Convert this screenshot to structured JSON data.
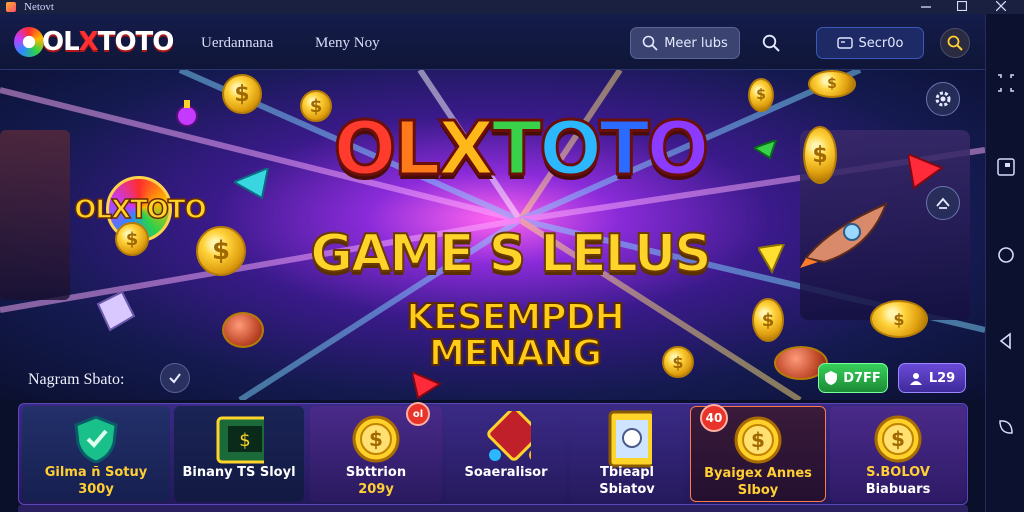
{
  "window": {
    "title": "Netovt",
    "controls": [
      "minimize",
      "maximize",
      "close"
    ]
  },
  "header": {
    "logo_prefix": "OL",
    "logo_x": "X",
    "logo_suffix": "TOTO",
    "nav": [
      "Uerdannana",
      "Meny Noy"
    ],
    "search_button": "Meer lubs",
    "secondary_button": "Secr0o",
    "icons": {
      "search": "search-icon",
      "lens": "search-icon",
      "user": "user-icon"
    }
  },
  "hero": {
    "badge_logo": "OLXTOTO",
    "title_letters": [
      "O",
      "L",
      "X",
      "T",
      "O",
      "T",
      "O"
    ],
    "title_colors": [
      "#ff3b2e",
      "#ff7a1a",
      "#ffb81a",
      "#3ad14a",
      "#2bb8ff",
      "#2b6bff",
      "#8a3bff"
    ],
    "subtitle": "GAME S LELUS",
    "tagline": "KESEMPDH MENANG",
    "chip_green": "D7FF",
    "chip_purple": "L29",
    "section_label": "Nagram Sbato:"
  },
  "games": [
    {
      "line1": "Gilma ñ Sotuy",
      "line2": "300y",
      "color1": "#ffcf33",
      "color2": "#ffcf33",
      "art": "shield-icon"
    },
    {
      "line1": "Binany TS Sloyl",
      "line2": "",
      "color1": "#ffffff",
      "color2": "#ffffff",
      "art": "slot-machine-icon"
    },
    {
      "line1": "Sbttrion",
      "line2": "209y",
      "color1": "#ffffff",
      "color2": "#ffcf33",
      "art": "coin-icon",
      "badge": "ol"
    },
    {
      "line1": "Soaeralisor",
      "line2": "",
      "color1": "#ffffff",
      "color2": "#ffffff",
      "art": "dice-icon"
    },
    {
      "line1": "Tbieapl",
      "line2": "Sbiatov",
      "color1": "#ffffff",
      "color2": "#ffffff",
      "art": "card-icon"
    },
    {
      "line1": "Byaigex Annes",
      "line2": "Slboy",
      "color1": "#ffcf33",
      "color2": "#ffcf33",
      "art": "coin-icon",
      "badge": "40"
    },
    {
      "line1": "S.BOLOV",
      "line2": "Biabuars",
      "color1": "#ffcf33",
      "color2": "#ffffff",
      "art": "coin-icon"
    }
  ],
  "rail": [
    "share-icon",
    "picture-in-picture-icon",
    "circle-icon",
    "back-icon",
    "rotate-icon"
  ],
  "colors": {
    "accent_gold": "#ffd42a",
    "brand_red": "#ff3030",
    "green_chip": "#2bb84a",
    "purple_chip": "#5a3fc0"
  }
}
